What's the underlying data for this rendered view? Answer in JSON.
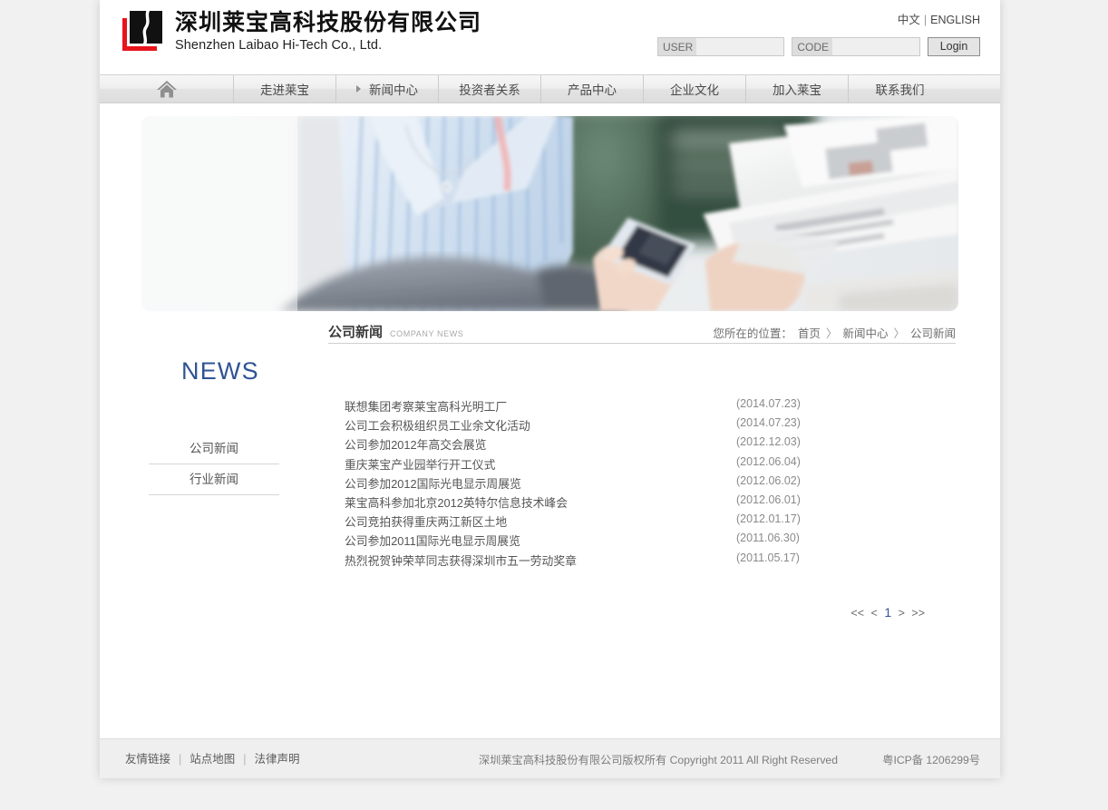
{
  "header": {
    "logo_cn": "深圳莱宝高科技股份有限公司",
    "logo_en": "Shenzhen Laibao Hi-Tech Co., Ltd.",
    "logo_icon": "laibao-logo-mark",
    "lang_cn": "中文",
    "lang_sep": "|",
    "lang_en": "ENGLISH",
    "login": {
      "user_label": "USER",
      "user_value": "",
      "user_placeholder": "",
      "code_label": "CODE",
      "code_value": "",
      "code_placeholder": "",
      "button_label": "Login"
    }
  },
  "nav": {
    "home_icon": "home-icon",
    "items": [
      {
        "label": "走进莱宝",
        "active": false,
        "arrow": false
      },
      {
        "label": "新闻中心",
        "active": true,
        "arrow": true
      },
      {
        "label": "投资者关系",
        "active": false,
        "arrow": false
      },
      {
        "label": "产品中心",
        "active": false,
        "arrow": false
      },
      {
        "label": "企业文化",
        "active": false,
        "arrow": false
      },
      {
        "label": "加入莱宝",
        "active": false,
        "arrow": false
      },
      {
        "label": "联系我们",
        "active": false,
        "arrow": false
      }
    ]
  },
  "banner": {
    "alt": "woman-holding-phone-and-newspaper"
  },
  "sidebar": {
    "heading": "NEWS",
    "items": [
      {
        "label": "公司新闻",
        "active": true
      },
      {
        "label": "行业新闻",
        "active": false
      }
    ]
  },
  "section": {
    "title_cn": "公司新闻",
    "title_en": "COMPANY NEWS"
  },
  "breadcrumb": {
    "lead": "您所在的位置：",
    "items": [
      "首页",
      "新闻中心",
      "公司新闻"
    ],
    "separator": "〉"
  },
  "news": {
    "rows": [
      {
        "title": "联想集团考察莱宝高科光明工厂",
        "date": "(2014.07.23)"
      },
      {
        "title": "公司工会积极组织员工业余文化活动",
        "date": "(2014.07.23)"
      },
      {
        "title": "公司参加2012年高交会展览",
        "date": "(2012.12.03)"
      },
      {
        "title": "重庆莱宝产业园举行开工仪式",
        "date": "(2012.06.04)"
      },
      {
        "title": "公司参加2012国际光电显示周展览",
        "date": "(2012.06.02)"
      },
      {
        "title": "莱宝高科参加北京2012英特尔信息技术峰会",
        "date": "(2012.06.01)"
      },
      {
        "title": "公司竞拍获得重庆两江新区土地",
        "date": "(2012.01.17)"
      },
      {
        "title": "公司参加2011国际光电显示周展览",
        "date": "(2011.06.30)"
      },
      {
        "title": "热烈祝贺钟荣苹同志获得深圳市五一劳动奖章",
        "date": "(2011.05.17)"
      }
    ]
  },
  "pagination": {
    "first": "<<",
    "prev": "<",
    "current": "1",
    "next": ">",
    "last": ">>"
  },
  "footer": {
    "links": [
      "友情链接",
      "站点地图",
      "法律声明"
    ],
    "link_separator": "|",
    "copyright": "深圳莱宝高科技股份有限公司版权所有 Copyright 2011 All Right Reserved",
    "icp": "粤ICP备 1206299号"
  },
  "colors": {
    "accent_blue": "#2f5494",
    "logo_red": "#e8141b",
    "page_bg": "#ffffff",
    "outer_bg": "#f1f1f1",
    "nav_bg": "#e8e8e8",
    "footer_bg": "#efefef"
  }
}
